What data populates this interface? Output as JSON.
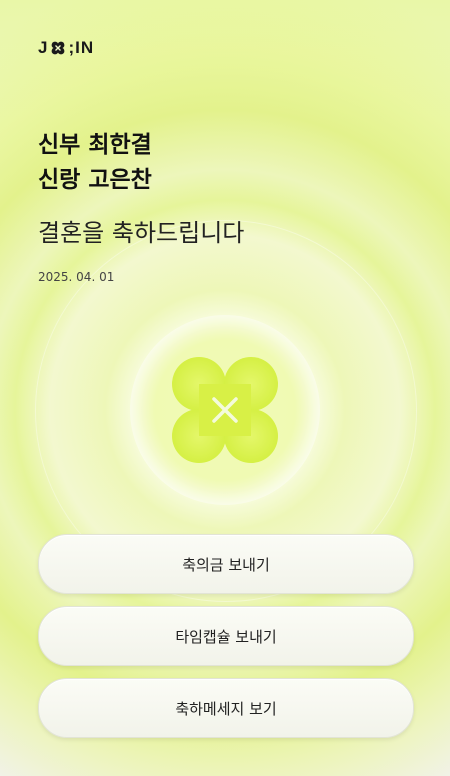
{
  "logo": {
    "part1": "J",
    "part2": ";IN"
  },
  "couple": {
    "bride": "신부 최한결",
    "groom": "신랑 고은찬"
  },
  "greeting": "결혼을 축하드립니다",
  "date": "2025. 04. 01",
  "buttons": {
    "gift": "축의금 보내기",
    "capsule": "타임캡슐 보내기",
    "messages": "축하메세지 보기"
  },
  "colors": {
    "accent": "#d8f050",
    "background": "#f2f2ee"
  }
}
